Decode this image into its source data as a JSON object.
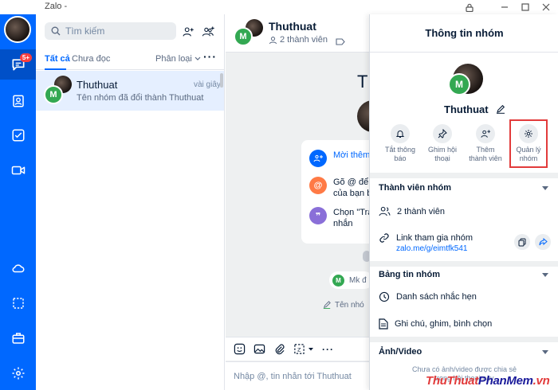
{
  "app": {
    "title": "Zalo -"
  },
  "rail": {
    "badge": "5+"
  },
  "conversation_list": {
    "search_placeholder": "Tìm kiếm",
    "tabs": [
      {
        "label": "Tất cả",
        "active": true
      },
      {
        "label": "Chưa đọc",
        "active": false
      }
    ],
    "filter_label": "Phân loại",
    "more_label": "···",
    "items": [
      {
        "avatar_letter": "M",
        "name": "Thuthuat",
        "time": "vài giây",
        "preview": "Tên nhóm đã đổi thành Thuthuat"
      }
    ]
  },
  "chat": {
    "header": {
      "avatar_letter": "M",
      "name": "Thuthuat",
      "members": "2 thành viên"
    },
    "big_title": "Th",
    "card_rows": [
      {
        "icon": "add-group-icon",
        "text": "Mời thêm",
        "style": "link"
      },
      {
        "icon": "at-icon",
        "text": "Gõ @ để t",
        "text2": "của bạn b"
      },
      {
        "icon": "quote-icon",
        "text": "Chọn \"Trả",
        "text2": "nhắn"
      }
    ],
    "notice_letter": "M",
    "notice": "Mk đ",
    "notice2": "Tên nhó",
    "composer_placeholder": "Nhập @, tin nhắn tới Thuthuat"
  },
  "group_info": {
    "title": "Thông tin nhóm",
    "avatar_letter": "M",
    "group_name": "Thuthuat",
    "actions": [
      {
        "icon": "bell-icon",
        "label_1": "Tắt thông",
        "label_2": "báo"
      },
      {
        "icon": "pin-icon",
        "label_1": "Ghim hội",
        "label_2": "thoại"
      },
      {
        "icon": "add-member-icon",
        "label_1": "Thêm",
        "label_2": "thành viên"
      },
      {
        "icon": "gear-icon",
        "label_1": "Quản lý",
        "label_2": "nhóm",
        "highlighted": true
      }
    ],
    "members_section": {
      "title": "Thành viên nhóm",
      "member_count": "2 thành viên",
      "invite_label": "Link tham gia nhóm",
      "invite_link": "zalo.me/g/eimtfk541"
    },
    "board_section": {
      "title": "Bảng tin nhóm",
      "reminders": "Danh sách nhắc hẹn",
      "notes": "Ghi chú, ghim, bình chọn"
    },
    "media_section": {
      "title": "Ảnh/Video",
      "empty_1": "Chưa có ảnh/video được chia sẻ",
      "empty_2": "trong hội thoại này"
    }
  },
  "watermark": {
    "part1": "ThuThuat",
    "part2": "PhanMem",
    "part3": ".vn"
  },
  "colors": {
    "brand": "#0068ff",
    "rail_active": "#0050c8",
    "avatar_green": "#33a852",
    "highlight_red": "#e23b3b"
  }
}
